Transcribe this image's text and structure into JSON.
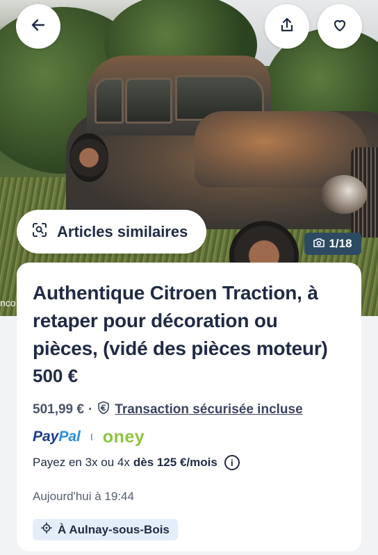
{
  "header": {
    "back_icon": "arrow-left-icon",
    "share_icon": "share-icon",
    "favorite_icon": "heart-icon"
  },
  "photo": {
    "similar_label": "Articles similaires",
    "similar_icon": "visual-search-icon",
    "counter_icon": "camera-icon",
    "counter": "1/18",
    "edge_text": "nco"
  },
  "listing": {
    "title": "Authentique Citroen Traction, à retaper pour décoration ou pièces, (vidé des pièces moteur)",
    "price": "500 €",
    "total_price": "501,99 €",
    "separator": "·",
    "secure_icon": "euro-shield-icon",
    "secure_link": "Transaction sécurisée incluse",
    "paypal_part1": "Pay",
    "paypal_part2": "Pal",
    "logo_separator": "I",
    "oney": "oney",
    "installments_prefix": "Payez en 3x ou 4x",
    "installments_bold": "dès 125 €/mois",
    "info_icon": "info-icon",
    "date": "Aujourd'hui à 19:44",
    "location_icon": "location-target-icon",
    "location": "À Aulnay-sous-Bois"
  },
  "colors": {
    "text_primary": "#1f2a44",
    "counter_bg": "#2c4b63",
    "paypal_dark": "#1b3a8a",
    "paypal_light": "#2c8ed6",
    "oney_green": "#8cc63f",
    "location_bg": "#e4eefb"
  }
}
